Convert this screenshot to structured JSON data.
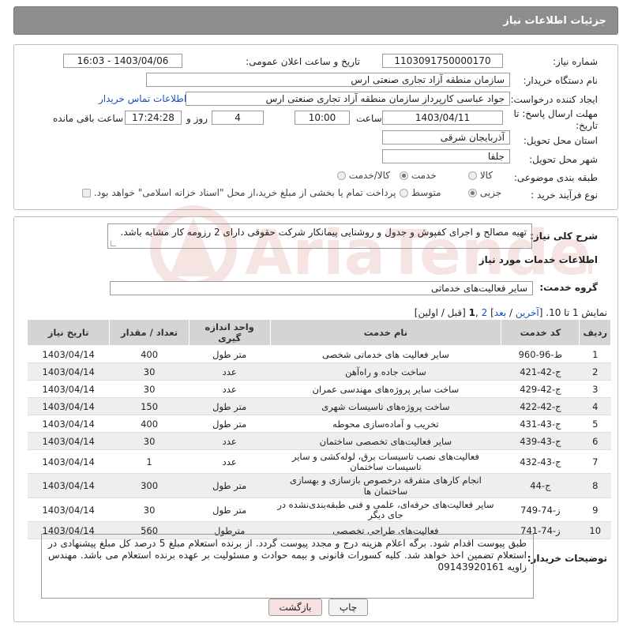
{
  "header": {
    "title": "جزئیات اطلاعات نیاز"
  },
  "need": {
    "number_label": "شماره نیاز:",
    "number_value": "1103091750000170",
    "announce_label": "تاریخ و ساعت اعلان عمومی:",
    "announce_value": "1403/04/06 - 16:03",
    "buyer_org_label": "نام دستگاه خریدار:",
    "buyer_org_value": "سازمان منطقه آزاد تجاری صنعتی ارس",
    "creator_label": "ایجاد کننده درخواست:",
    "creator_value": "جواد عباسی کارپرداز سازمان منطقه آزاد تجاری صنعتی ارس",
    "contact_link": "اطلاعات تماس خریدار",
    "deadline_label": "مهلت ارسال پاسخ: تا تاریخ:",
    "deadline_date": "1403/04/11",
    "time_label": "ساعت",
    "deadline_time": "10:00",
    "days_value": "4",
    "days_label": "روز و",
    "remaining_time": "17:24:28",
    "remaining_label": "ساعت باقی مانده",
    "province_label": "استان محل تحویل:",
    "province_value": "آذربایجان شرقی",
    "city_label": "شهر محل تحویل:",
    "city_value": "جلفا",
    "category_label": "طبقه بندی موضوعی:",
    "category_options": [
      "کالا",
      "خدمت",
      "کالا/خدمت"
    ],
    "category_selected": "خدمت",
    "process_label": "نوع فرآیند خرید :",
    "process_options": [
      "جزیی",
      "متوسط"
    ],
    "process_selected": "جزیی",
    "payment_note": "پرداخت تمام یا بخشی از مبلغ خرید،از محل \"اسناد خزانه اسلامی\" خواهد بود."
  },
  "details": {
    "general_label": "شرح کلی نیاز:",
    "general_value": "تهیه مصالح و اجرای کفپوش و جدول و روشنایی پیمانکار شرکت حقوقی دارای 2 رزومه کار مشابه باشد.",
    "services_heading": "اطلاعات خدمات مورد نیاز",
    "service_group_label": "گروه خدمت:",
    "service_group_value": "سایر فعالیت‌های خدماتی",
    "pagination": {
      "prefix": "نمایش 1 تا 10. [",
      "last": "آخرین",
      "sep1": " / ",
      "next": "بعد",
      "suffix": "] ",
      "page2": "2",
      "page1": "1",
      "tail": "[قبل / اولین]"
    },
    "columns": [
      "ردیف",
      "کد خدمت",
      "نام خدمت",
      "واحد اندازه گیری",
      "تعداد / مقدار",
      "تاریخ نیاز"
    ],
    "rows": [
      {
        "n": "1",
        "code": "ط-96-960",
        "name": "سایر فعالیت های خدماتی شخصی",
        "unit": "متر طول",
        "qty": "400",
        "date": "1403/04/14"
      },
      {
        "n": "2",
        "code": "ج-42-421",
        "name": "ساخت جاده و راه‌آهن",
        "unit": "عدد",
        "qty": "30",
        "date": "1403/04/14"
      },
      {
        "n": "3",
        "code": "ج-42-429",
        "name": "ساخت سایر پروژه‌های مهندسی عمران",
        "unit": "عدد",
        "qty": "30",
        "date": "1403/04/14"
      },
      {
        "n": "4",
        "code": "ج-42-422",
        "name": "ساخت پروژه‌های تاسیسات شهری",
        "unit": "متر طول",
        "qty": "150",
        "date": "1403/04/14"
      },
      {
        "n": "5",
        "code": "ج-43-431",
        "name": "تخریب و آماده‌سازی محوطه",
        "unit": "متر طول",
        "qty": "400",
        "date": "1403/04/14"
      },
      {
        "n": "6",
        "code": "ج-43-439",
        "name": "سایر فعالیت‌های تخصصی ساختمان",
        "unit": "عدد",
        "qty": "30",
        "date": "1403/04/14"
      },
      {
        "n": "7",
        "code": "ج-43-432",
        "name": "فعالیت‌های نصب تاسیسات برق، لوله‌کشی و سایر تاسیسات ساختمان",
        "unit": "عدد",
        "qty": "1",
        "date": "1403/04/14"
      },
      {
        "n": "8",
        "code": "ج-44",
        "name": "انجام کارهای متفرقه درخصوص بازسازی و بهسازی ساختمان ها",
        "unit": "متر طول",
        "qty": "300",
        "date": "1403/04/14"
      },
      {
        "n": "9",
        "code": "ز-74-749",
        "name": "سایر فعالیت‌های حرفه‌ای، علمی و فنی طبقه‌بندی‌نشده در جای دیگر",
        "unit": "متر طول",
        "qty": "30",
        "date": "1403/04/14"
      },
      {
        "n": "10",
        "code": "ز-74-741",
        "name": "فعالیت‌های طراحی تخصصی",
        "unit": "مترطول",
        "qty": "560",
        "date": "1403/04/14"
      }
    ],
    "buyer_desc_label": "توضیحات خریدار:",
    "buyer_desc_value": "طبق پیوست اقدام شود. برگه اعلام هزینه درج و مجدد پیوست گردد. از برنده استعلام مبلغ 5 درصد کل مبلغ پیشنهادی در استعلام تضمین اخذ خواهد شد. کلیه کسورات قانونی و بیمه حوادث و مسئولیت بر عهده برنده استعلام می باشد. مهندس زاویه 09143920161"
  },
  "buttons": {
    "print": "چاپ",
    "back": "بازگشت"
  },
  "colors": {
    "header_bg": "#8d8d8d",
    "link": "#1a4fb5",
    "back_btn_bg": "#f7e1e1",
    "watermark": "#c0392b"
  }
}
